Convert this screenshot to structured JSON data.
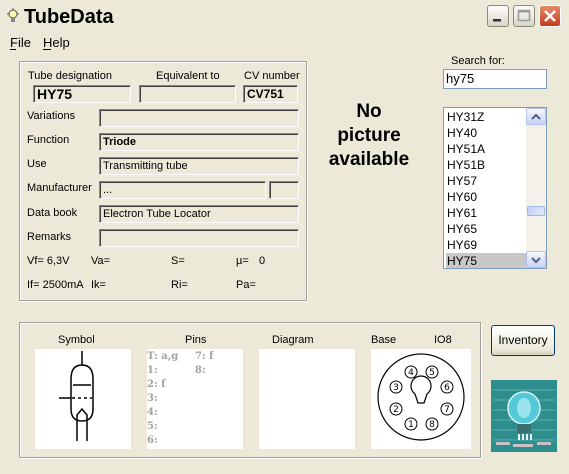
{
  "window": {
    "title": "TubeData"
  },
  "menu": {
    "file": "File",
    "help": "Help"
  },
  "search": {
    "label": "Search for:",
    "value": "hy75"
  },
  "tube": {
    "designation_label": "Tube designation",
    "designation": "HY75",
    "equivalent_label": "Equivalent to",
    "equivalent": "",
    "cv_label": "CV number",
    "cv": "CV751",
    "variations_label": "Variations",
    "variations": "",
    "function_label": "Function",
    "function": "Triode",
    "use_label": "Use",
    "use": "Transmitting tube",
    "manufacturer_label": "Manufacturer",
    "manufacturer": "...",
    "databook_label": "Data book",
    "databook": "Electron Tube Locator",
    "remarks_label": "Remarks",
    "remarks": ""
  },
  "params": {
    "vf": "Vf= 6,3V",
    "va": "Va=",
    "s": "S=",
    "mu": "µ=",
    "mu_value": "0",
    "if": "If= 2500mA",
    "ik": "Ik=",
    "ri": "Ri=",
    "pa": "Pa="
  },
  "picture": {
    "line1": "No",
    "line2": "picture",
    "line3": "available"
  },
  "tube_list": [
    "HY31Z",
    "HY40",
    "HY51A",
    "HY51B",
    "HY57",
    "HY60",
    "HY61",
    "HY65",
    "HY69",
    "HY75"
  ],
  "selected_tube": "HY75",
  "bottom": {
    "symbol": "Symbol",
    "pins": "Pins",
    "diagram": "Diagram",
    "base": "Base",
    "base_type": "IO8"
  },
  "pins": {
    "t": "T: a,g",
    "p1": "1:",
    "p2": "2: f",
    "p3": "3:",
    "p4": "4:",
    "p5": "5:",
    "p6": "6:",
    "p7": "7: f",
    "p8": "8:"
  },
  "base_pins": [
    "1",
    "2",
    "3",
    "4",
    "5",
    "6",
    "7",
    "8"
  ],
  "buttons": {
    "inventory": "Inventory"
  },
  "colors": {
    "title_close": "#c8391b",
    "list_selection": "#c8c8c8",
    "logo_bg": "#2a8a8a"
  }
}
